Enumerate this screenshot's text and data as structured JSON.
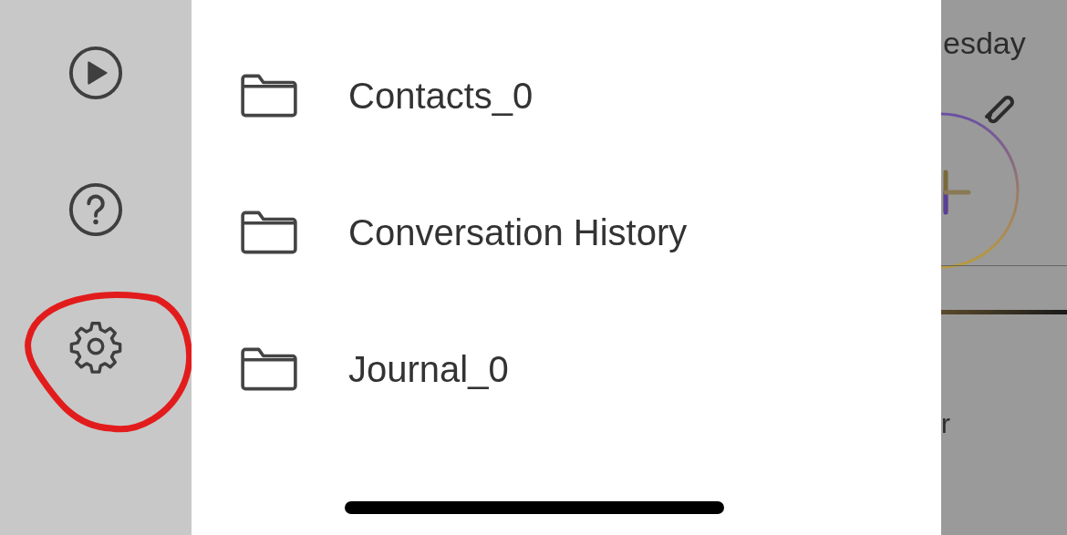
{
  "rail": {
    "items": [
      {
        "kind": "play"
      },
      {
        "kind": "help"
      },
      {
        "kind": "settings"
      }
    ]
  },
  "annotation": {
    "kind": "circle"
  },
  "folders": [
    {
      "name": "Contacts_0"
    },
    {
      "name": "Conversation History"
    },
    {
      "name": "Journal_0"
    }
  ],
  "background_screen": {
    "day_text": "esday",
    "row_text": "r"
  }
}
